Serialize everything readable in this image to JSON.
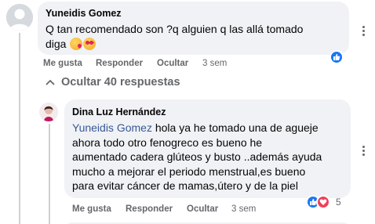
{
  "comments": [
    {
      "author": "Yuneidis Gomez",
      "text_line1": "Q tan recomendado son ?q alguien q las allá tomado",
      "text_line2": "diga",
      "emojis": [
        "kissing-heart-emoji",
        "heart-eyes-emoji"
      ],
      "actions": {
        "like": "Me gusta",
        "reply": "Responder",
        "hide": "Ocultar",
        "time": "3 sem"
      },
      "reactions": [
        "like"
      ]
    },
    {
      "author": "Dina Luz Hernández",
      "mention": "Yuneidis Gomez",
      "text_line1_rest": " hola ya he tomado una de agueje",
      "text_line2": "ahora todo otro fenogreco es bueno he",
      "text_line3": "aumentado cadera glúteos y busto ..además ayuda",
      "text_line4": "mucho a mejorar el periodo menstrual,es bueno",
      "text_line5": "para evitar cáncer de mamas,útero y de la piel",
      "actions": {
        "like": "Me gusta",
        "reply": "Responder",
        "hide": "Ocultar",
        "time": "3 sem"
      },
      "reactions": [
        "like",
        "love"
      ],
      "reaction_count": "5"
    }
  ],
  "replies_toggle": {
    "label": "Ocultar 40 respuestas"
  },
  "colors": {
    "bubble": "#f0f2f5",
    "meta": "#65676b",
    "like": "#1877f2",
    "love": "#f33e58",
    "mention": "#385898"
  }
}
